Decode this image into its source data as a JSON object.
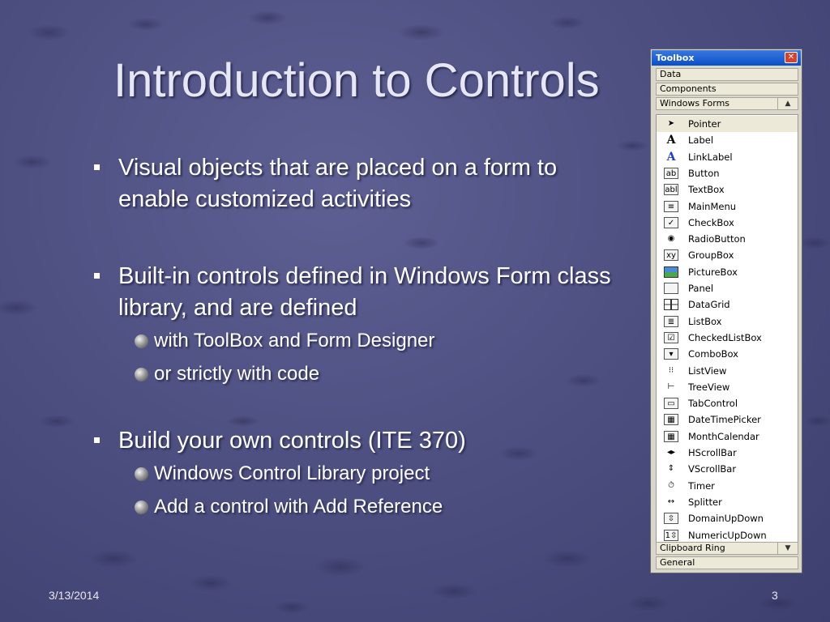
{
  "slide": {
    "title": "Introduction to Controls",
    "bullets": [
      {
        "text": "Visual objects that are placed on a form to enable  customized activities"
      },
      {
        "text": "Built-in controls defined in Windows Form class library, and are defined",
        "subs": [
          "with ToolBox and Form Designer",
          "or strictly with code"
        ]
      },
      {
        "text": "Build your own controls (ITE 370)",
        "subs": [
          "Windows Control Library project",
          "Add a control with Add Reference"
        ]
      }
    ],
    "date": "3/13/2014",
    "page": "3"
  },
  "toolbox": {
    "title": "Toolbox",
    "tabs_top": [
      "Data",
      "Components",
      "Windows Forms"
    ],
    "tabs_bottom": [
      "Clipboard Ring",
      "General"
    ],
    "items": [
      {
        "label": "Pointer",
        "icon": "pointer-icon",
        "glyph": "➤"
      },
      {
        "label": "Label",
        "icon": "label-icon",
        "glyph": "A"
      },
      {
        "label": "LinkLabel",
        "icon": "linklabel-icon",
        "glyph": "A"
      },
      {
        "label": "Button",
        "icon": "button-icon",
        "glyph": "ab"
      },
      {
        "label": "TextBox",
        "icon": "textbox-icon",
        "glyph": "abl"
      },
      {
        "label": "MainMenu",
        "icon": "mainmenu-icon",
        "glyph": "≡"
      },
      {
        "label": "CheckBox",
        "icon": "checkbox-icon",
        "glyph": "✓"
      },
      {
        "label": "RadioButton",
        "icon": "radiobutton-icon",
        "glyph": "◉"
      },
      {
        "label": "GroupBox",
        "icon": "groupbox-icon",
        "glyph": "xy"
      },
      {
        "label": "PictureBox",
        "icon": "picturebox-icon",
        "glyph": ""
      },
      {
        "label": "Panel",
        "icon": "panel-icon",
        "glyph": ""
      },
      {
        "label": "DataGrid",
        "icon": "datagrid-icon",
        "glyph": ""
      },
      {
        "label": "ListBox",
        "icon": "listbox-icon",
        "glyph": "≣"
      },
      {
        "label": "CheckedListBox",
        "icon": "checkedlistbox-icon",
        "glyph": "☑"
      },
      {
        "label": "ComboBox",
        "icon": "combobox-icon",
        "glyph": "▾"
      },
      {
        "label": "ListView",
        "icon": "listview-icon",
        "glyph": "⁝⁝"
      },
      {
        "label": "TreeView",
        "icon": "treeview-icon",
        "glyph": "⊢"
      },
      {
        "label": "TabControl",
        "icon": "tabcontrol-icon",
        "glyph": "▭"
      },
      {
        "label": "DateTimePicker",
        "icon": "datetimepicker-icon",
        "glyph": "▦"
      },
      {
        "label": "MonthCalendar",
        "icon": "monthcalendar-icon",
        "glyph": "▦"
      },
      {
        "label": "HScrollBar",
        "icon": "hscrollbar-icon",
        "glyph": "◂▸"
      },
      {
        "label": "VScrollBar",
        "icon": "vscrollbar-icon",
        "glyph": "⇕"
      },
      {
        "label": "Timer",
        "icon": "timer-icon",
        "glyph": "⏱"
      },
      {
        "label": "Splitter",
        "icon": "splitter-icon",
        "glyph": "↔"
      },
      {
        "label": "DomainUpDown",
        "icon": "domainupdown-icon",
        "glyph": "⇳"
      },
      {
        "label": "NumericUpDown",
        "icon": "numericupdown-icon",
        "glyph": "1⇳"
      }
    ]
  }
}
